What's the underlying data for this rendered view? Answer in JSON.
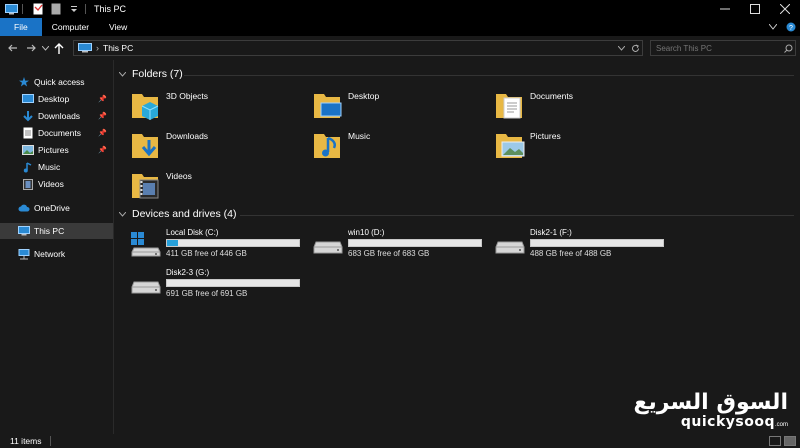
{
  "titlebar": {
    "title": "This PC",
    "icons": [
      "computer-icon",
      "properties-icon",
      "new-folder-icon",
      "customize-toolbar-icon"
    ],
    "controls": [
      "chevron-up-icon",
      "minimize-icon",
      "maximize-icon",
      "close-icon"
    ]
  },
  "ribbon": {
    "tabs": [
      {
        "label": "File",
        "active": true,
        "color": "#1a73c6"
      },
      {
        "label": "Computer"
      },
      {
        "label": "View"
      }
    ],
    "right_icons": [
      "expand-ribbon-icon",
      "help-icon"
    ]
  },
  "navigation": {
    "back_icon": "back-arrow-icon",
    "forward_icon": "forward-arrow-icon",
    "recent_icon": "chevron-down-icon",
    "up_icon": "up-arrow-icon",
    "address": {
      "path": "This PC",
      "icon": "computer-icon"
    },
    "search": {
      "placeholder": "Search This PC",
      "icon": "search-icon"
    }
  },
  "sidebar": {
    "items": [
      {
        "label": "Quick access",
        "icon": "star-icon",
        "color": "#2a8ad4"
      },
      {
        "label": "Desktop",
        "icon": "desktop-icon",
        "pinned": true
      },
      {
        "label": "Downloads",
        "icon": "download-icon",
        "pinned": true
      },
      {
        "label": "Documents",
        "icon": "documents-icon",
        "pinned": true
      },
      {
        "label": "Pictures",
        "icon": "pictures-icon",
        "pinned": true
      },
      {
        "label": "Music",
        "icon": "music-icon"
      },
      {
        "label": "Videos",
        "icon": "videos-icon"
      },
      {
        "label": "OneDrive",
        "icon": "cloud-icon"
      },
      {
        "label": "This PC",
        "icon": "computer-icon",
        "active": true
      },
      {
        "label": "Network",
        "icon": "network-icon"
      }
    ]
  },
  "folders": {
    "header": "Folders (7)",
    "items": [
      {
        "label": "3D Objects",
        "icon": "3d-objects-folder-icon"
      },
      {
        "label": "Desktop",
        "icon": "desktop-folder-icon"
      },
      {
        "label": "Documents",
        "icon": "documents-folder-icon"
      },
      {
        "label": "Downloads",
        "icon": "downloads-folder-icon"
      },
      {
        "label": "Music",
        "icon": "music-folder-icon"
      },
      {
        "label": "Pictures",
        "icon": "pictures-folder-icon"
      },
      {
        "label": "Videos",
        "icon": "videos-folder-icon"
      }
    ]
  },
  "drives": {
    "header": "Devices and drives (4)",
    "items": [
      {
        "name": "Local Disk (C:)",
        "free": "411 GB free of 446 GB",
        "used_fraction": 0.08,
        "icon": "windows-drive-icon"
      },
      {
        "name": "win10 (D:)",
        "free": "683 GB free of 683 GB",
        "used_fraction": 0.0,
        "icon": "hard-drive-icon"
      },
      {
        "name": "Disk2-1 (F:)",
        "free": "488 GB free of 488 GB",
        "used_fraction": 0.0,
        "icon": "hard-drive-icon"
      },
      {
        "name": "Disk2-3 (G:)",
        "free": "691 GB free of 691 GB",
        "used_fraction": 0.0,
        "icon": "hard-drive-icon"
      }
    ]
  },
  "status": {
    "count": "11 items",
    "view_icons": [
      "details-view-icon",
      "large-icons-view-icon"
    ]
  },
  "watermark": {
    "arabic": "السوق السريع",
    "latin": "quickysooq",
    "domain": ".com"
  },
  "colors": {
    "background": "#191919",
    "accent": "#1a73c6",
    "folder": "#e8b844",
    "bar_fill": "#26a0da"
  }
}
